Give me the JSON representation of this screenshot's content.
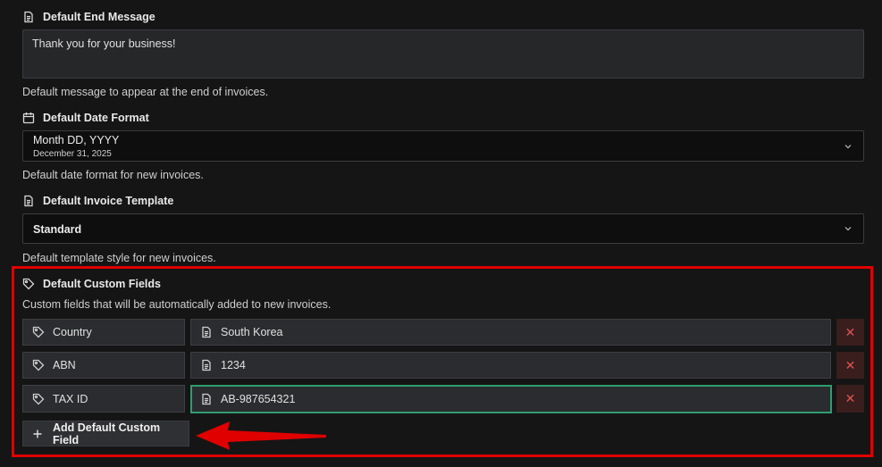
{
  "end_message": {
    "title": "Default End Message",
    "value": "Thank you for your business!",
    "help": "Default message to appear at the end of invoices."
  },
  "date_format": {
    "title": "Default Date Format",
    "value": "Month DD, YYYY",
    "example": "December 31, 2025",
    "help": "Default date format for new invoices."
  },
  "invoice_template": {
    "title": "Default Invoice Template",
    "value": "Standard",
    "help": "Default template style for new invoices."
  },
  "custom_fields": {
    "title": "Default Custom Fields",
    "help": "Custom fields that will be automatically added to new invoices.",
    "rows": [
      {
        "name": "Country",
        "value": "South Korea"
      },
      {
        "name": "ABN",
        "value": "1234"
      },
      {
        "name": "TAX ID",
        "value": "AB-987654321"
      }
    ],
    "delete_glyph": "✕",
    "add_label": "Add Default Custom Field"
  },
  "colors": {
    "background": "#151515",
    "highlight": "#e00000",
    "active_border": "#2f9e6f",
    "delete": "#e05252"
  }
}
